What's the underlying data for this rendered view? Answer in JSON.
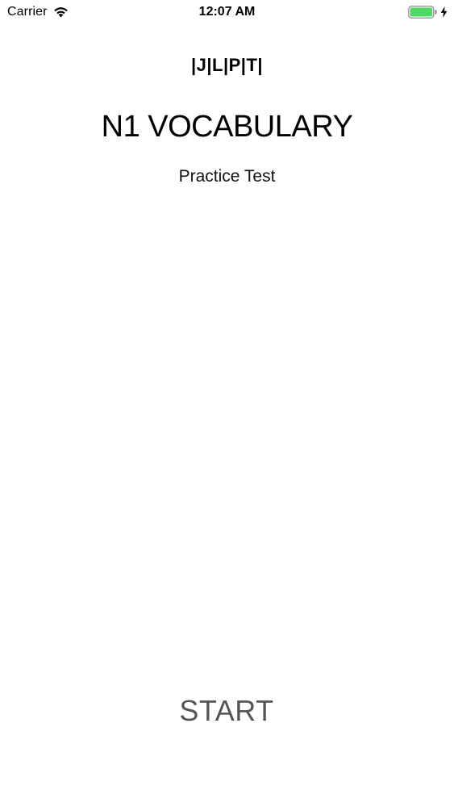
{
  "status_bar": {
    "carrier": "Carrier",
    "time": "12:07 AM",
    "wifi_icon": "wifi-icon",
    "battery_icon": "battery-icon",
    "charging_icon": "bolt-icon",
    "battery_color": "#4cd964"
  },
  "app": {
    "brand": "|J|L|P|T|",
    "title": "N1 VOCABULARY",
    "subtitle": "Practice Test"
  },
  "actions": {
    "start_label": "START"
  }
}
